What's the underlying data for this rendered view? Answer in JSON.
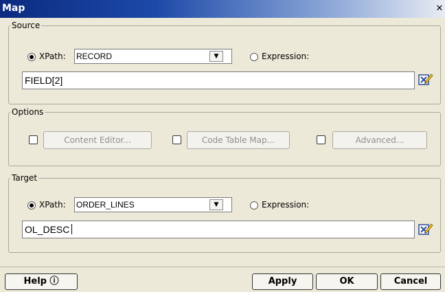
{
  "window": {
    "title": "Map",
    "close_glyph": "✕"
  },
  "source": {
    "legend": "Source",
    "xpath_label": "XPath:",
    "xpath_value": "RECORD",
    "xpath_selected": true,
    "expression_label": "Expression:",
    "expression_selected": false,
    "field_value": "FIELD[2]",
    "edit_icon": "edit-pencil-icon"
  },
  "options": {
    "legend": "Options",
    "buttons": [
      {
        "label": "Content Editor...",
        "checked": false,
        "enabled": false
      },
      {
        "label": "Code Table Map...",
        "checked": false,
        "enabled": false
      },
      {
        "label": "Advanced...",
        "checked": false,
        "enabled": false
      }
    ]
  },
  "target": {
    "legend": "Target",
    "xpath_label": "XPath:",
    "xpath_value": "ORDER_LINES",
    "xpath_selected": true,
    "expression_label": "Expression:",
    "expression_selected": false,
    "field_value": "OL_DESC",
    "edit_icon": "edit-pencil-icon"
  },
  "footer": {
    "help_label": "Help ⓘ",
    "apply_label": "Apply",
    "ok_label": "OK",
    "cancel_label": "Cancel"
  },
  "colors": {
    "title_gradient_start": "#0b2a80",
    "dialog_bg": "#ece9d8"
  }
}
